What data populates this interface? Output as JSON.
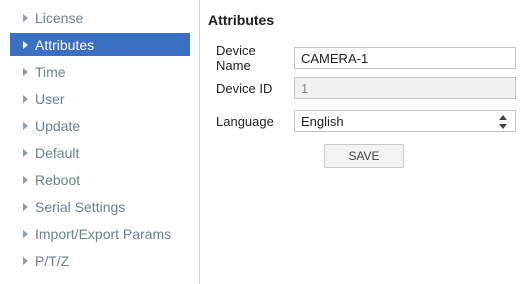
{
  "sidebar": {
    "items": [
      {
        "label": "License"
      },
      {
        "label": "Attributes"
      },
      {
        "label": "Time"
      },
      {
        "label": "User"
      },
      {
        "label": "Update"
      },
      {
        "label": "Default"
      },
      {
        "label": "Reboot"
      },
      {
        "label": "Serial Settings"
      },
      {
        "label": "Import/Export Params"
      },
      {
        "label": "P/T/Z"
      }
    ],
    "active": "Attributes"
  },
  "main": {
    "title": "Attributes",
    "device_name": {
      "label": "Device Name",
      "value": "CAMERA-1"
    },
    "device_id": {
      "label": "Device ID",
      "value": "1"
    },
    "language": {
      "label": "Language",
      "selected": "English"
    },
    "save_label": "SAVE"
  },
  "colors": {
    "accent": "#3a6fc2",
    "sidebar_text": "#6b7f95"
  },
  "icons": {
    "sidebar_item": "caret-right-icon",
    "select": "up-down-chevron-icon"
  }
}
